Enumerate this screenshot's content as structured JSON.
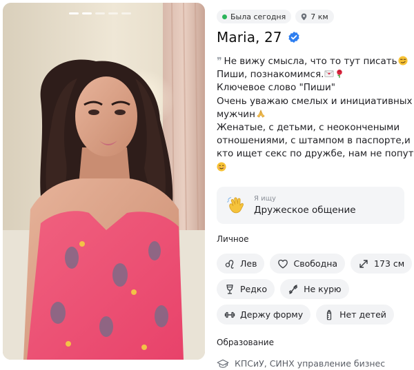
{
  "profile": {
    "status": "Была сегодня",
    "distance": "7 км",
    "name_age": "Maria, 27",
    "about_lines": [
      "Не вижу смысла, что то тут писать",
      "Пиши, познакомимся.",
      "Ключевое слово \"Пиши\"",
      "Очень уважаю смелых и инициативных",
      "мужчин",
      "Женатые, с детьми, с неокончеными",
      "отношениями, с штампом в паспорте,и",
      "кто ищет секс по дружбе, нам не попути"
    ]
  },
  "seeking": {
    "label": "Я ищу",
    "value": "Дружеское общение",
    "icon": "waving-hand-icon"
  },
  "personal": {
    "title": "Личное",
    "tags": [
      {
        "icon": "zodiac-leo-icon",
        "label": "Лев"
      },
      {
        "icon": "heart-icon",
        "label": "Свободна"
      },
      {
        "icon": "height-arrow-icon",
        "label": "173 см"
      },
      {
        "icon": "wine-glass-icon",
        "label": "Редко"
      },
      {
        "icon": "no-smoking-icon",
        "label": "Не курю"
      },
      {
        "icon": "dumbbell-icon",
        "label": "Держу форму"
      },
      {
        "icon": "baby-bottle-icon",
        "label": "Нет детей"
      }
    ]
  },
  "education": {
    "title": "Образование",
    "value": "КПСиУ, СИНХ управление бизнес",
    "icon": "graduation-cap-icon"
  },
  "colors": {
    "online": "#2bb45a",
    "verified": "#2f7ff0",
    "chip_bg": "#f2f3f5",
    "card_bg": "#f4f5f7"
  }
}
